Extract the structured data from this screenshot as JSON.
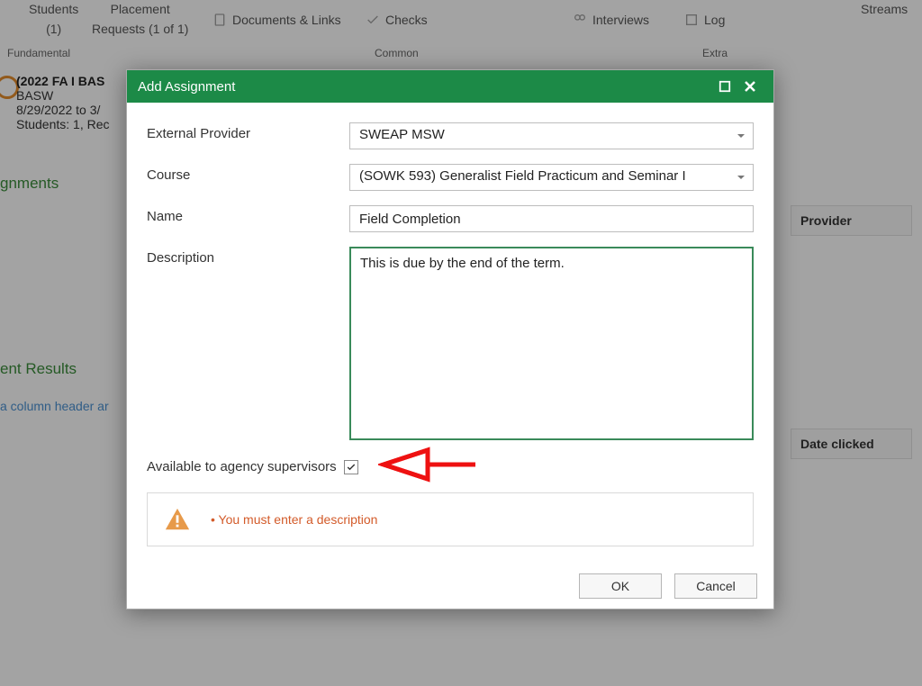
{
  "ribbon": {
    "students": "Students",
    "students_count": "(1)",
    "placement": "Placement",
    "placement_sub": "Requests (1 of 1)",
    "documents": "Documents & Links",
    "checks": "Checks",
    "interviews": "Interviews",
    "log": "Log",
    "streams": "Streams",
    "group_fundamental": "Fundamental",
    "group_common": "Common",
    "group_extra": "Extra"
  },
  "side": {
    "title": "(2022 FA I BAS",
    "line2": "BASW",
    "line3": "8/29/2022 to 3/",
    "line4": "Students: 1, Rec"
  },
  "sections": {
    "assignments": "gnments",
    "results": "ent Results",
    "hint": "a column header ar"
  },
  "bg_columns": {
    "provider": "Provider",
    "date_clicked": "Date clicked"
  },
  "modal": {
    "title": "Add Assignment",
    "labels": {
      "external_provider": "External Provider",
      "course": "Course",
      "name": "Name",
      "description": "Description",
      "available": "Available to agency supervisors"
    },
    "values": {
      "external_provider": "SWEAP MSW",
      "course": "(SOWK 593) Generalist Field Practicum and Seminar I",
      "name": "Field Completion",
      "description": "This is due by the end of the term."
    },
    "available_checked": true,
    "warning": "• You must enter a description",
    "buttons": {
      "ok": "OK",
      "cancel": "Cancel"
    }
  }
}
